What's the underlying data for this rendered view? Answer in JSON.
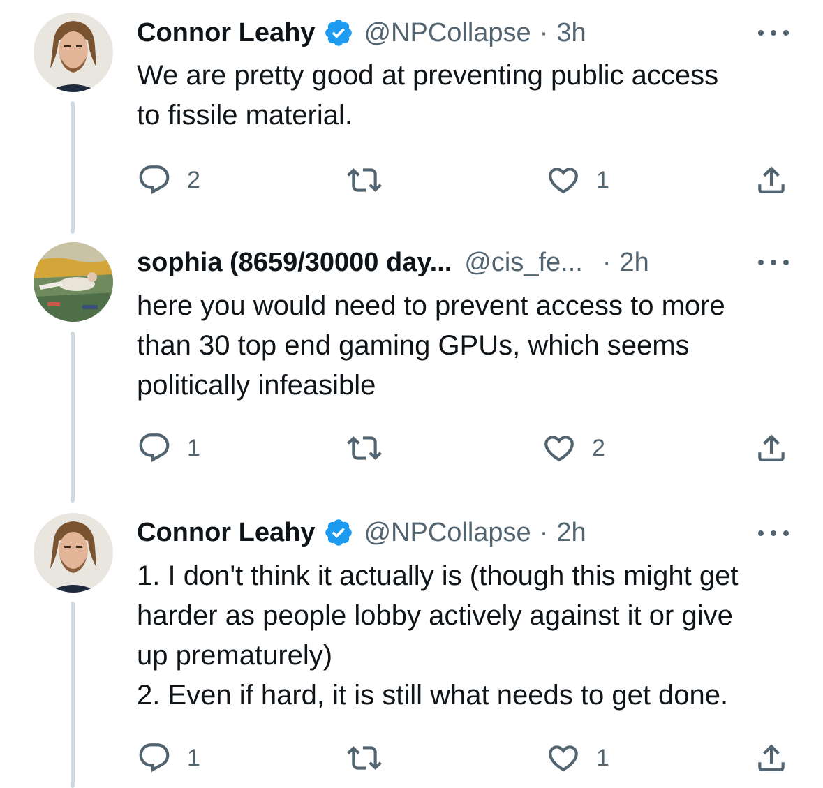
{
  "tweets": [
    {
      "author_name": "Connor Leahy",
      "verified": true,
      "handle": "@NPCollapse",
      "separator": "·",
      "time": "3h",
      "text_lines": [
        "We are pretty good at preventing public access",
        "to fissile material."
      ],
      "replies": "2",
      "reposts": "",
      "likes": "1"
    },
    {
      "author_name": "sophia (8659/30000 day...",
      "verified": false,
      "handle": "@cis_fe...",
      "separator": "·",
      "time": "2h",
      "text_lines": [
        "here you would need to prevent access to more",
        "than 30 top end gaming GPUs, which seems",
        "politically infeasible"
      ],
      "replies": "1",
      "reposts": "",
      "likes": "2"
    },
    {
      "author_name": "Connor Leahy",
      "verified": true,
      "handle": "@NPCollapse",
      "separator": "·",
      "time": "2h",
      "text_lines": [
        "1. I don't think it actually is (though this might get",
        "harder as people lobby actively against it or give",
        "up prematurely)",
        "2. Even if hard, it is still what needs to get done."
      ],
      "replies": "1",
      "reposts": "",
      "likes": "1"
    }
  ],
  "colors": {
    "text": "#0f1419",
    "secondary": "#536471",
    "verified_blue": "#1d9bf0",
    "thread_line": "#cfd9de"
  },
  "icons": {
    "reply": "reply-icon",
    "repost": "repost-icon",
    "like": "like-icon",
    "share": "share-icon",
    "verified": "verified-badge-icon",
    "more": "more-icon"
  }
}
